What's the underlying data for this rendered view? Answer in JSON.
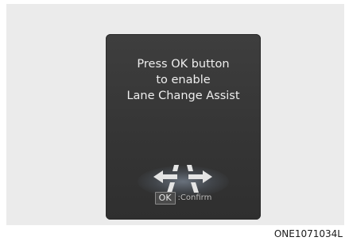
{
  "display": {
    "message_lines": [
      "Press OK button",
      "to enable",
      "Lane Change Assist"
    ],
    "ok_key_label": "OK",
    "confirm_label": ":Confirm",
    "graphic_icon": "lane-change-arrows-icon"
  },
  "figure_code": "ONE1071034L",
  "colors": {
    "screen_background": "#3a3a3a",
    "text": "#eeeeee",
    "arrow": "#e6e6e6",
    "glow": "#96a5b9"
  }
}
